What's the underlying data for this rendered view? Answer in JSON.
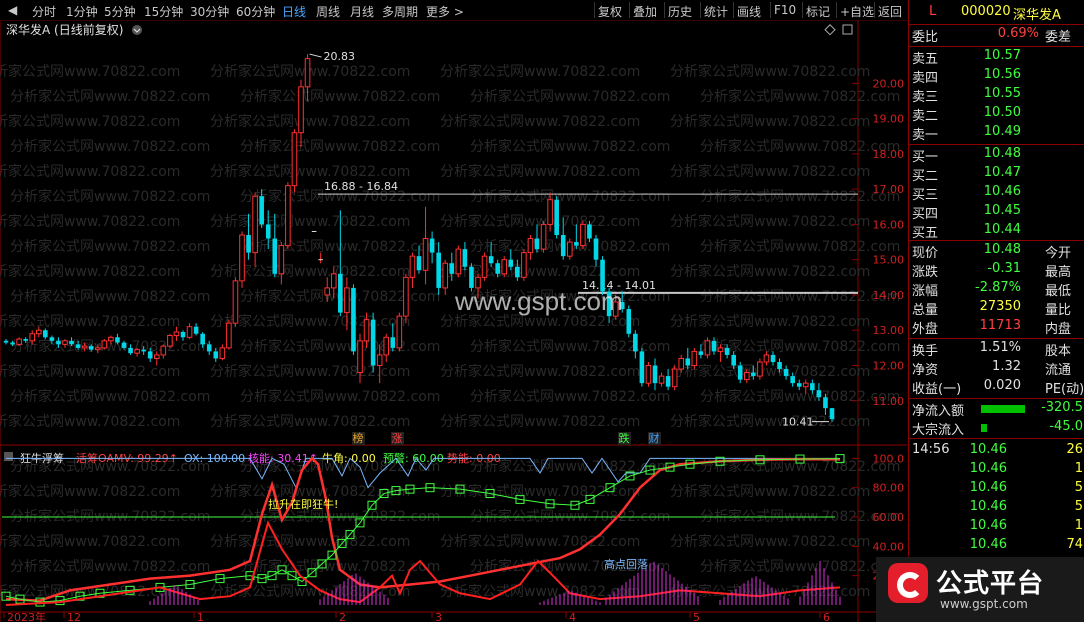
{
  "toolbar": {
    "periods": [
      "分时",
      "1分钟",
      "5分钟",
      "15分钟",
      "30分钟",
      "60分钟",
      "日线",
      "周线",
      "月线",
      "多周期",
      "更多 >"
    ],
    "active_period": "日线",
    "actions": [
      "复权",
      "叠加",
      "历史",
      "统计",
      "画线",
      "F10",
      "标记",
      "+自选",
      "返回"
    ]
  },
  "chart": {
    "title": "深华发A (日线前复权)",
    "price_ticks": [
      "20.00",
      "19.00",
      "18.00",
      "17.00",
      "16.00",
      "15.00",
      "14.00",
      "13.00",
      "12.00",
      "11.00"
    ],
    "high_label": "20.83",
    "low_label": "10.41",
    "range1": "16.88 - 16.84",
    "range2": "14.14 - 14.01",
    "event_markers": [
      "榜",
      "涨",
      "跌",
      "财"
    ],
    "watermark_text": "www.gspt.com",
    "faint_watermark": "分析家公式网www.70822.com",
    "x_labels": [
      "2023年",
      "12",
      "1",
      "2",
      "3",
      "4",
      "5",
      "6"
    ]
  },
  "indicator": {
    "name": "狂牛浮筹",
    "items": [
      {
        "label": "活筹OAMV: 99.29↑",
        "color": "#ff4040"
      },
      {
        "label": "OX: 100.00",
        "color": "#7ab8ff"
      },
      {
        "label": "核能: 30.41↑",
        "color": "#ff40ff"
      },
      {
        "label": "牛角: 0.00",
        "color": "#ffff40"
      },
      {
        "label": "预警: 60.00",
        "color": "#40ff40"
      },
      {
        "label": "势能: 0.00",
        "color": "#ff4040"
      }
    ],
    "ticks": [
      "100.0",
      "80.00",
      "60.00",
      "40.00",
      "20.00"
    ],
    "note1": "拉升在即狂牛!",
    "note2": "高点回落"
  },
  "quote": {
    "indicator_letter": "L",
    "code": "000020",
    "name": "深华发A",
    "weibi_label": "委比",
    "weibi_value": "0.69%",
    "weicha_label": "委差",
    "sells": [
      {
        "label": "卖五",
        "price": "10.57"
      },
      {
        "label": "卖四",
        "price": "10.56"
      },
      {
        "label": "卖三",
        "price": "10.55"
      },
      {
        "label": "卖二",
        "price": "10.50"
      },
      {
        "label": "卖一",
        "price": "10.49"
      }
    ],
    "buys": [
      {
        "label": "买一",
        "price": "10.48"
      },
      {
        "label": "买二",
        "price": "10.47"
      },
      {
        "label": "买三",
        "price": "10.46"
      },
      {
        "label": "买四",
        "price": "10.45"
      },
      {
        "label": "买五",
        "price": "10.44"
      }
    ],
    "stats": [
      {
        "label": "现价",
        "value": "10.48",
        "label2": "今开",
        "color": "#40ff40"
      },
      {
        "label": "涨跌",
        "value": "-0.31",
        "label2": "最高",
        "color": "#40ff40"
      },
      {
        "label": "涨幅",
        "value": "-2.87%",
        "label2": "最低",
        "color": "#40ff40"
      },
      {
        "label": "总量",
        "value": "27350",
        "label2": "量比",
        "color": "#ffff40"
      },
      {
        "label": "外盘",
        "value": "11713",
        "label2": "内盘",
        "color": "#ff4040"
      }
    ],
    "stats2": [
      {
        "label": "换手",
        "value": "1.51%",
        "label2": "股本"
      },
      {
        "label": "净资",
        "value": "1.32",
        "label2": "流通"
      },
      {
        "label": "收益(一)",
        "value": "0.020",
        "label2": "PE(动)"
      }
    ],
    "flows": [
      {
        "label": "净流入额",
        "value": "-320.5"
      },
      {
        "label": "大宗流入",
        "value": "-45.0"
      }
    ],
    "ticks": {
      "time": "14:56",
      "rows": [
        {
          "price": "10.46",
          "vol": "26"
        },
        {
          "price": "10.46",
          "vol": "1"
        },
        {
          "price": "10.46",
          "vol": "5"
        },
        {
          "price": "10.46",
          "vol": "5"
        },
        {
          "price": "10.46",
          "vol": "1"
        },
        {
          "price": "10.46",
          "vol": "74"
        },
        {
          "price": "10.46",
          "vol": "29"
        }
      ]
    }
  },
  "logo": {
    "title": "公式平台",
    "url": "www.gspt.com"
  },
  "colors": {
    "up": "#ff3030",
    "down": "#00d8e8",
    "grid": "#5a0000"
  },
  "chart_data": {
    "type": "candlestick",
    "candles": [
      [
        12.7,
        12.75,
        12.6,
        12.65
      ],
      [
        12.65,
        12.7,
        12.55,
        12.6
      ],
      [
        12.6,
        12.8,
        12.55,
        12.75
      ],
      [
        12.75,
        12.8,
        12.65,
        12.7
      ],
      [
        12.7,
        13.0,
        12.6,
        12.9
      ],
      [
        12.9,
        13.1,
        12.8,
        13.0
      ],
      [
        13.0,
        13.05,
        12.75,
        12.8
      ],
      [
        12.8,
        12.85,
        12.6,
        12.7
      ],
      [
        12.7,
        12.8,
        12.5,
        12.6
      ],
      [
        12.6,
        12.75,
        12.5,
        12.7
      ],
      [
        12.7,
        12.8,
        12.55,
        12.6
      ],
      [
        12.6,
        12.7,
        12.45,
        12.5
      ],
      [
        12.5,
        12.65,
        12.4,
        12.55
      ],
      [
        12.55,
        12.6,
        12.4,
        12.45
      ],
      [
        12.45,
        12.6,
        12.35,
        12.5
      ],
      [
        12.5,
        12.75,
        12.45,
        12.7
      ],
      [
        12.7,
        12.85,
        12.6,
        12.8
      ],
      [
        12.8,
        12.9,
        12.6,
        12.65
      ],
      [
        12.65,
        12.7,
        12.45,
        12.5
      ],
      [
        12.5,
        12.6,
        12.3,
        12.35
      ],
      [
        12.35,
        12.5,
        12.25,
        12.45
      ],
      [
        12.45,
        12.55,
        12.3,
        12.4
      ],
      [
        12.4,
        12.5,
        12.1,
        12.2
      ],
      [
        12.2,
        12.4,
        12.0,
        12.3
      ],
      [
        12.3,
        12.6,
        12.2,
        12.55
      ],
      [
        12.55,
        12.9,
        12.5,
        12.85
      ],
      [
        12.85,
        13.1,
        12.7,
        12.95
      ],
      [
        12.95,
        13.0,
        12.7,
        12.8
      ],
      [
        12.8,
        13.2,
        12.75,
        13.1
      ],
      [
        13.1,
        13.2,
        12.85,
        12.9
      ],
      [
        12.9,
        12.95,
        12.5,
        12.6
      ],
      [
        12.6,
        12.7,
        12.3,
        12.4
      ],
      [
        12.4,
        12.5,
        12.1,
        12.2
      ],
      [
        12.2,
        12.6,
        12.15,
        12.5
      ],
      [
        12.5,
        13.3,
        12.45,
        13.2
      ],
      [
        13.2,
        14.5,
        13.1,
        14.4
      ],
      [
        14.4,
        15.8,
        14.2,
        15.7
      ],
      [
        15.7,
        16.3,
        15.0,
        15.2
      ],
      [
        15.2,
        16.9,
        14.8,
        16.8
      ],
      [
        16.8,
        17.0,
        15.9,
        16.0
      ],
      [
        16.0,
        16.4,
        15.3,
        15.6
      ],
      [
        15.6,
        16.3,
        14.5,
        14.6
      ],
      [
        14.6,
        15.5,
        14.3,
        15.4
      ],
      [
        15.4,
        17.2,
        15.3,
        17.1
      ],
      [
        17.1,
        18.7,
        16.9,
        18.6
      ],
      [
        18.6,
        20.1,
        18.2,
        19.9
      ],
      [
        19.9,
        20.83,
        19.5,
        20.7
      ],
      [
        15.8,
        15.8,
        15.8,
        15.8
      ],
      [
        15.0,
        15.2,
        14.9,
        15.0
      ],
      [
        14.0,
        14.5,
        13.8,
        14.2
      ],
      [
        14.2,
        14.8,
        13.9,
        14.6
      ],
      [
        14.6,
        16.4,
        13.4,
        13.5
      ],
      [
        13.5,
        14.5,
        13.0,
        14.2
      ],
      [
        14.2,
        14.3,
        12.3,
        12.4
      ],
      [
        11.8,
        12.9,
        11.5,
        12.7
      ],
      [
        12.7,
        13.5,
        12.5,
        13.3
      ],
      [
        13.3,
        13.5,
        11.8,
        12.0
      ],
      [
        12.0,
        12.6,
        11.5,
        12.3
      ],
      [
        12.3,
        12.9,
        12.1,
        12.8
      ],
      [
        12.8,
        13.2,
        12.4,
        12.5
      ],
      [
        12.5,
        13.5,
        12.4,
        13.4
      ],
      [
        13.4,
        14.6,
        13.2,
        14.5
      ],
      [
        14.5,
        15.2,
        14.2,
        15.1
      ],
      [
        15.1,
        15.4,
        14.6,
        14.7
      ],
      [
        14.7,
        16.5,
        14.3,
        15.6
      ],
      [
        15.6,
        15.8,
        14.9,
        15.2
      ],
      [
        15.2,
        15.5,
        14.0,
        14.2
      ],
      [
        14.2,
        15.0,
        14.0,
        14.9
      ],
      [
        14.9,
        15.2,
        14.4,
        14.6
      ],
      [
        14.6,
        15.4,
        14.5,
        15.3
      ],
      [
        15.3,
        15.5,
        14.7,
        14.8
      ],
      [
        14.8,
        14.9,
        14.1,
        14.2
      ],
      [
        14.2,
        14.6,
        13.9,
        14.5
      ],
      [
        14.5,
        15.2,
        14.4,
        15.1
      ],
      [
        15.1,
        15.5,
        14.8,
        14.9
      ],
      [
        14.9,
        15.0,
        14.5,
        14.6
      ],
      [
        14.6,
        15.1,
        14.5,
        15.0
      ],
      [
        15.0,
        15.3,
        14.7,
        14.8
      ],
      [
        14.8,
        15.0,
        14.4,
        14.5
      ],
      [
        14.5,
        15.3,
        14.4,
        15.2
      ],
      [
        15.2,
        15.7,
        15.0,
        15.6
      ],
      [
        15.6,
        16.0,
        15.2,
        15.3
      ],
      [
        15.3,
        16.1,
        15.2,
        16.0
      ],
      [
        16.0,
        16.9,
        15.8,
        16.7
      ],
      [
        16.7,
        16.8,
        15.6,
        15.7
      ],
      [
        15.7,
        16.2,
        15.0,
        15.1
      ],
      [
        15.1,
        15.6,
        15.0,
        15.5
      ],
      [
        15.5,
        16.0,
        15.3,
        15.4
      ],
      [
        15.4,
        16.1,
        15.3,
        16.0
      ],
      [
        16.0,
        16.1,
        15.5,
        15.6
      ],
      [
        15.6,
        15.7,
        14.8,
        15.0
      ],
      [
        15.0,
        15.1,
        14.0,
        14.1
      ],
      [
        14.1,
        14.2,
        13.2,
        13.4
      ],
      [
        13.4,
        14.0,
        13.3,
        13.8
      ],
      [
        13.8,
        14.1,
        13.5,
        13.6
      ],
      [
        13.6,
        13.7,
        12.8,
        12.9
      ],
      [
        12.9,
        13.0,
        12.2,
        12.4
      ],
      [
        12.4,
        12.5,
        11.4,
        11.5
      ],
      [
        11.5,
        12.1,
        11.4,
        12.0
      ],
      [
        12.0,
        12.2,
        11.3,
        11.5
      ],
      [
        11.5,
        11.8,
        11.4,
        11.7
      ],
      [
        11.7,
        11.9,
        11.3,
        11.4
      ],
      [
        11.4,
        12.0,
        11.3,
        11.9
      ],
      [
        11.9,
        12.3,
        11.8,
        12.2
      ],
      [
        12.2,
        12.5,
        11.9,
        12.0
      ],
      [
        12.0,
        12.5,
        11.9,
        12.4
      ],
      [
        12.4,
        12.6,
        12.2,
        12.3
      ],
      [
        12.3,
        12.8,
        12.2,
        12.7
      ],
      [
        12.7,
        12.8,
        12.3,
        12.4
      ],
      [
        12.4,
        12.6,
        12.1,
        12.5
      ],
      [
        12.5,
        12.6,
        12.2,
        12.3
      ],
      [
        12.3,
        12.4,
        11.9,
        12.0
      ],
      [
        12.0,
        12.1,
        11.5,
        11.6
      ],
      [
        11.6,
        11.9,
        11.5,
        11.8
      ],
      [
        11.8,
        12.0,
        11.6,
        11.7
      ],
      [
        11.7,
        12.2,
        11.6,
        12.1
      ],
      [
        12.1,
        12.4,
        12.0,
        12.3
      ],
      [
        12.3,
        12.4,
        12.0,
        12.1
      ],
      [
        12.1,
        12.2,
        11.8,
        11.9
      ],
      [
        11.9,
        12.0,
        11.6,
        11.7
      ],
      [
        11.7,
        11.8,
        11.4,
        11.5
      ],
      [
        11.5,
        11.6,
        11.3,
        11.4
      ],
      [
        11.4,
        11.6,
        11.2,
        11.5
      ],
      [
        11.5,
        11.6,
        11.2,
        11.3
      ],
      [
        11.3,
        11.5,
        11.0,
        11.1
      ],
      [
        11.1,
        11.2,
        10.6,
        10.79
      ],
      [
        10.79,
        10.8,
        10.41,
        10.48
      ]
    ],
    "ylim": [
      10.2,
      21.2
    ],
    "indicator_ylim": [
      0,
      105
    ]
  }
}
